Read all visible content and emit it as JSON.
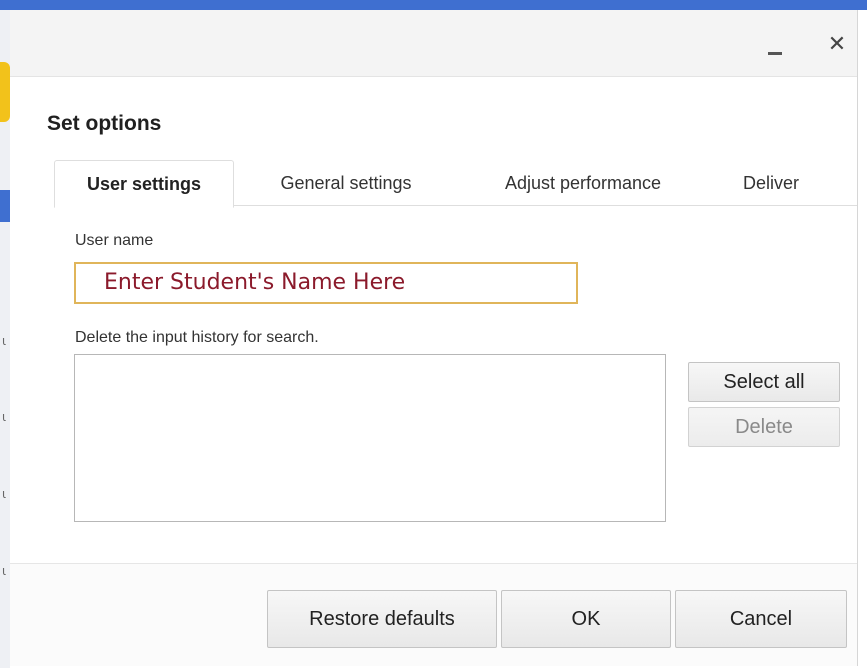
{
  "dialog": {
    "title": "Set options",
    "window_controls": {
      "minimize_icon": "minimize-icon",
      "close_label": "✕"
    }
  },
  "tabs": [
    {
      "label": "User settings",
      "active": true
    },
    {
      "label": "General settings",
      "active": false
    },
    {
      "label": "Adjust performance",
      "active": false
    },
    {
      "label": "Deliver",
      "active": false
    }
  ],
  "user_settings": {
    "user_name_label": "User name",
    "user_name_value": "Enter Student's Name Here",
    "history_label": "Delete the input history for search.",
    "select_all_label": "Select all",
    "delete_label": "Delete"
  },
  "footer": {
    "restore_label": "Restore defaults",
    "ok_label": "OK",
    "cancel_label": "Cancel"
  },
  "colors": {
    "accent_blue": "#3f6fd0",
    "input_border": "#e0b55a",
    "input_text": "#8b1a2b"
  }
}
